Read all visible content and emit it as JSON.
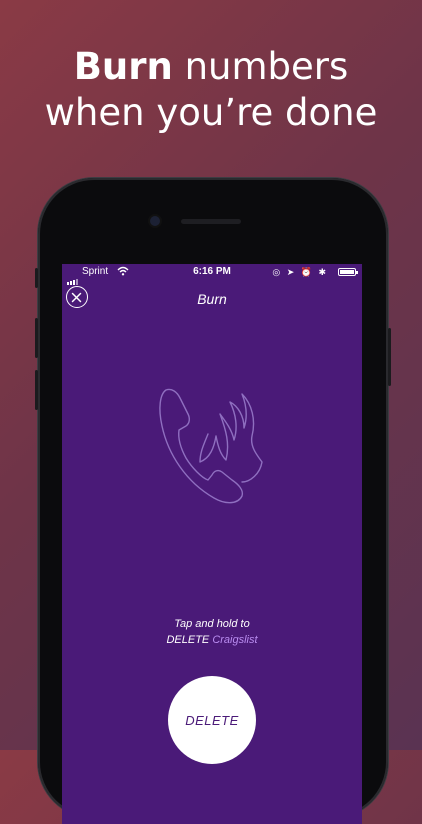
{
  "headline": {
    "bold": "Burn",
    "rest": " numbers",
    "line2": "when you’re done"
  },
  "status_bar": {
    "carrier": "Sprint",
    "time": "6:16 PM",
    "icons": "◎ ➤ ⏰ ✱"
  },
  "nav": {
    "title": "Burn"
  },
  "instruction": {
    "line1": "Tap and hold to",
    "action": "DELETE ",
    "target": "Craigslist"
  },
  "delete_button": {
    "label": "DELETE"
  },
  "colors": {
    "screen_bg": "#4a1a78",
    "accent": "#b98cf0",
    "button": "#ffffff"
  }
}
